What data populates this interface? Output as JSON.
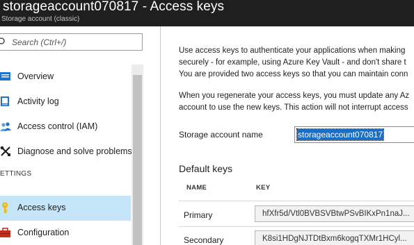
{
  "window": {
    "title": "storageaccount070817 - Access keys",
    "subtitle": "Storage account (classic)"
  },
  "search": {
    "placeholder": "Search (Ctrl+/)"
  },
  "sidebar": {
    "items": [
      {
        "label": "Overview",
        "icon": "overview-icon"
      },
      {
        "label": "Activity log",
        "icon": "activity-log-icon"
      },
      {
        "label": "Access control (IAM)",
        "icon": "people-icon"
      },
      {
        "label": "Diagnose and solve problems",
        "icon": "wrench-icon"
      },
      {
        "label": "Access keys",
        "icon": "key-icon",
        "active": true
      },
      {
        "label": "Configuration",
        "icon": "toolbox-icon"
      }
    ],
    "section_label": "ETTINGS"
  },
  "main": {
    "description": [
      "Use access keys to authenticate your applications when making",
      "securely - for example, using Azure Key Vault - and don't share t",
      "You are provided two access keys so that you can maintain conn"
    ],
    "regen_description": [
      "When you regenerate your access keys, you must update any Az",
      "account to use the new keys. This action will not interrupt access"
    ],
    "account_name_label": "Storage account name",
    "account_name_value": "storageaccount070817",
    "default_keys_title": "Default keys",
    "columns": [
      "NAME",
      "KEY"
    ],
    "keys": [
      {
        "name": "Primary",
        "key": "hfXfr5d/Vtl0BVBSVBtwPSvBIKxPn1naJ..."
      },
      {
        "name": "Secondary",
        "key": "K8si1HDgNJTDtBxm6kogqTXMr1HCyl..."
      }
    ]
  },
  "colors": {
    "titlebar": "#1f1f1f",
    "active_item": "#c4e4f7",
    "selection": "#1b6ec2",
    "key_icon": "#f2b705"
  }
}
